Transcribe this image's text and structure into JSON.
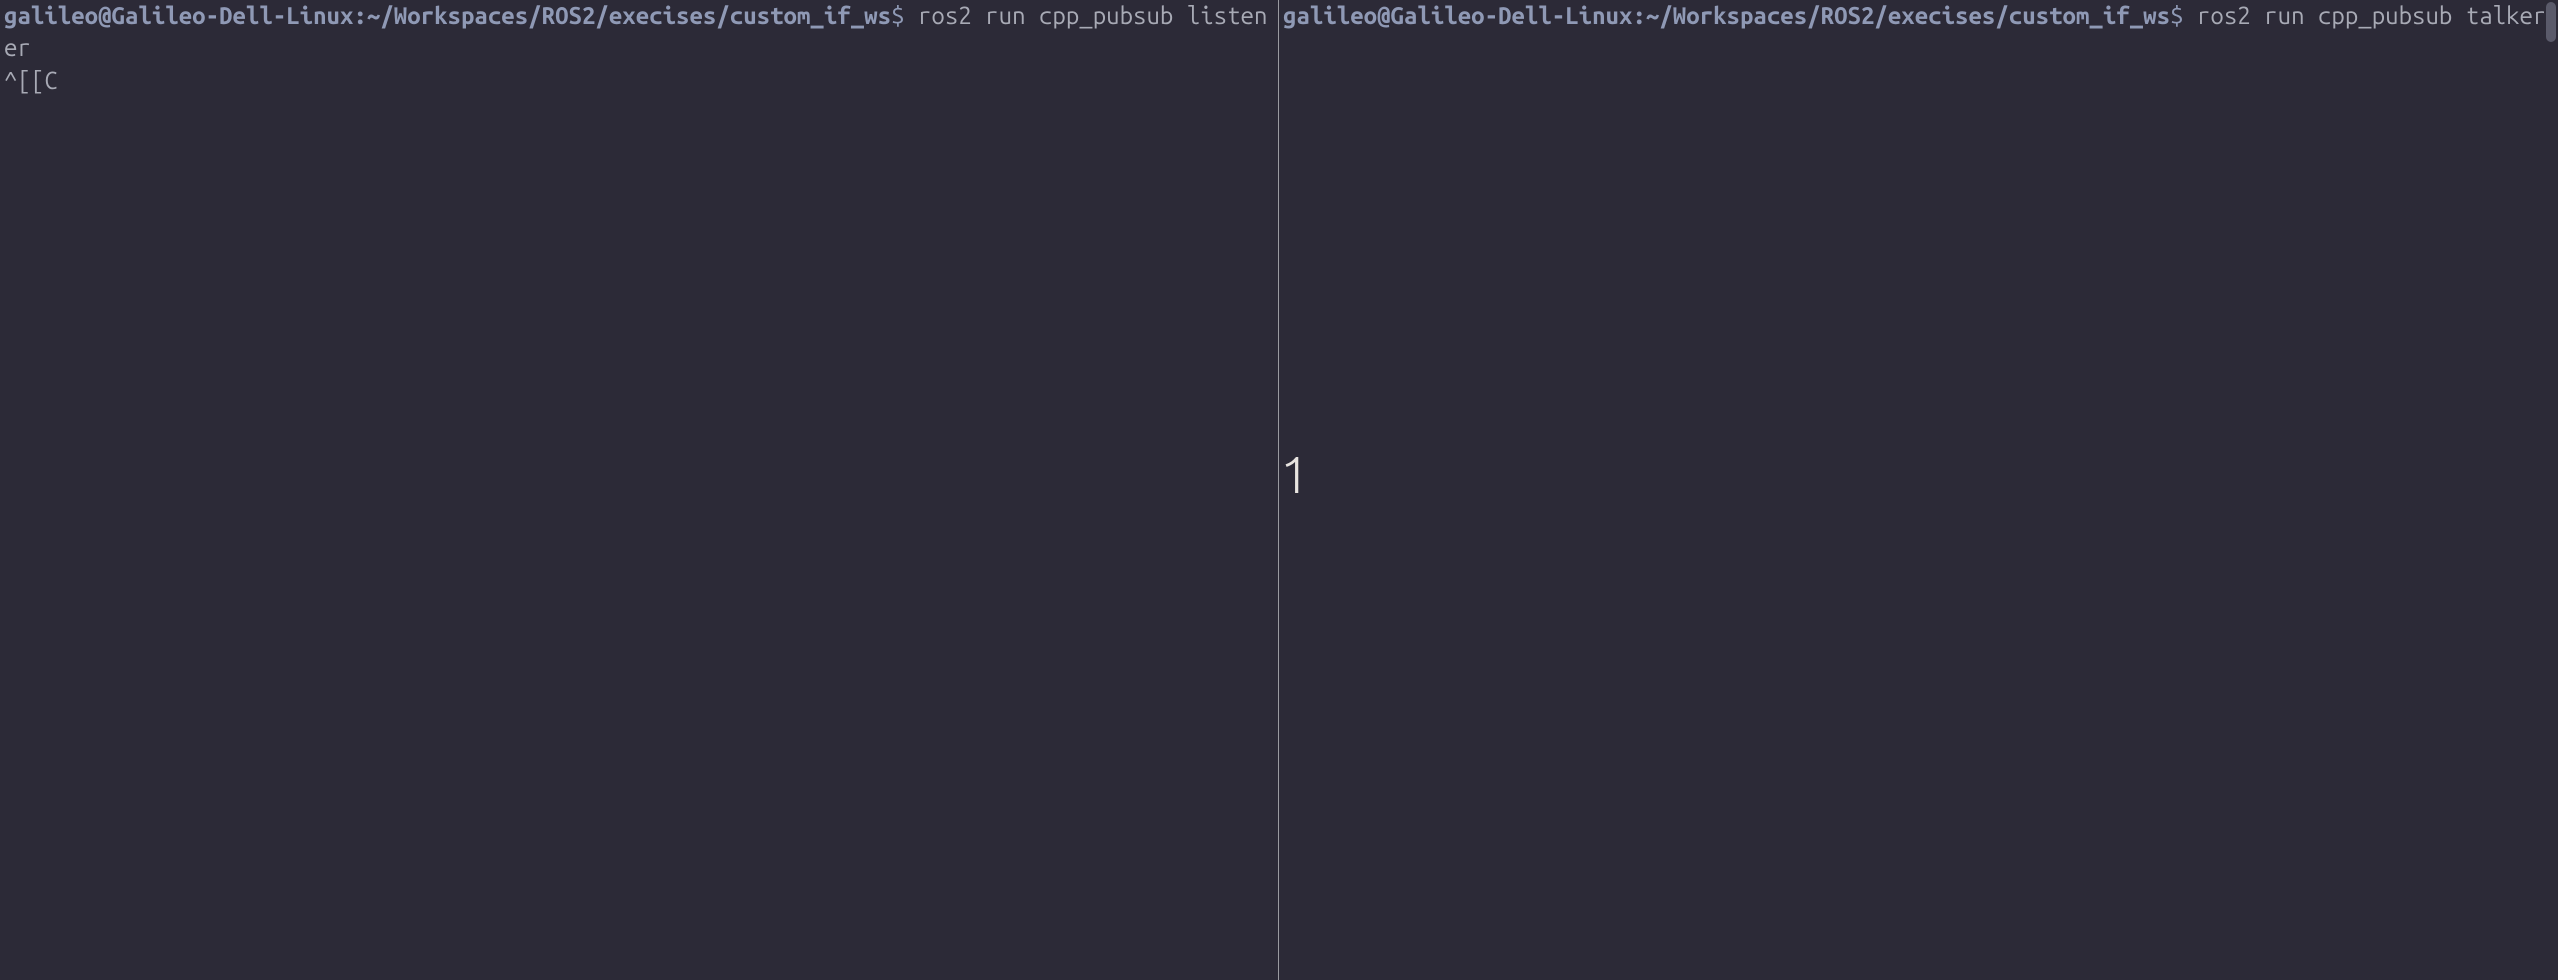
{
  "left_pane": {
    "prompt_user_host": "galileo@Galileo-Dell-Linux",
    "prompt_separator": ":",
    "prompt_path": "~/Workspaces/ROS2/execises/custom_if_ws",
    "prompt_symbol": "$",
    "command": "ros2 run cpp_pubsub listener",
    "output_line": "^[[C"
  },
  "right_pane": {
    "prompt_user_host": "galileo@Galileo-Dell-Linux",
    "prompt_separator": ":",
    "prompt_path": "~/Workspaces/ROS2/execises/custom_if_ws",
    "prompt_symbol": "$",
    "command": "ros2 run cpp_pubsub talker"
  },
  "overlay": {
    "pane_number": "1"
  }
}
